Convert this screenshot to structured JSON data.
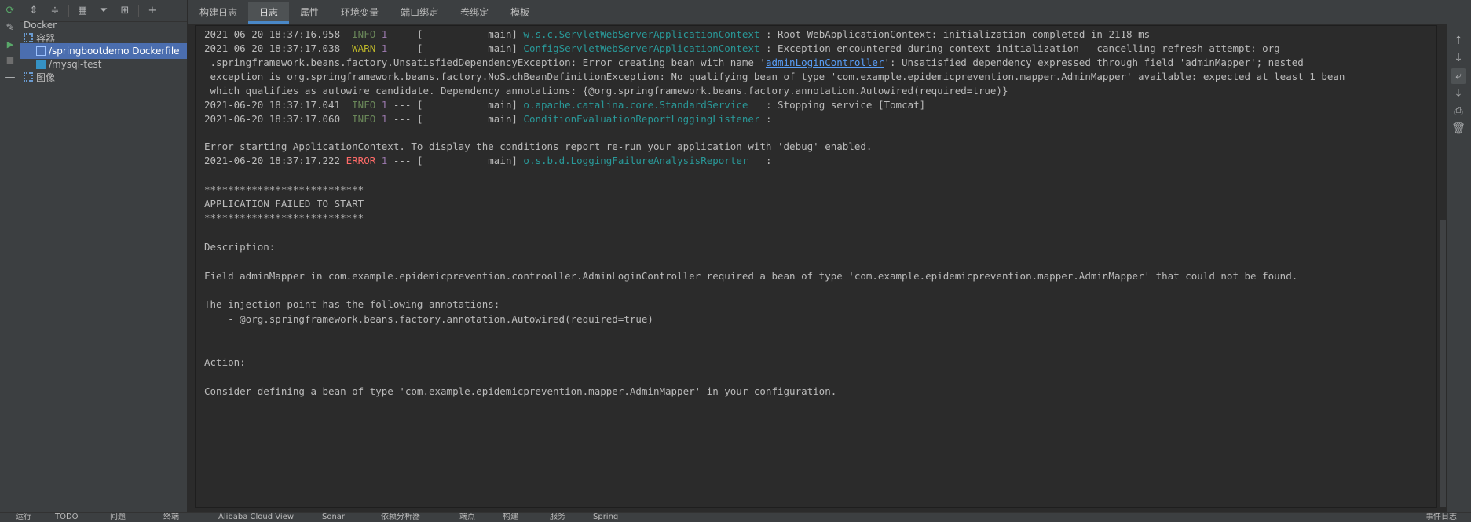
{
  "left_toolbar": {
    "icons": [
      "refresh-icon",
      "edit-icon",
      "run-icon",
      "stop-icon",
      "minus-icon"
    ]
  },
  "top_toolbar": {
    "icons": [
      "expand-all-icon",
      "collapse-all-icon",
      "group-icon",
      "filter-icon",
      "new-group-icon",
      "add-icon"
    ]
  },
  "tree": {
    "root": "Docker",
    "containers_label": "容器",
    "containers": [
      "/springbootdemo Dockerfile",
      "/mysql-test"
    ],
    "images_label": "图像"
  },
  "tabs": [
    "构建日志",
    "日志",
    "属性",
    "环境变量",
    "端口绑定",
    "卷绑定",
    "模板"
  ],
  "active_tab": "日志",
  "log": {
    "line1": {
      "ts": "2021-06-20 18:37:16.958  ",
      "level": "INFO",
      "pid": " 1",
      "sep": " --- [           main] ",
      "cls": "w.s.c.ServletWebServerApplicationContext",
      "msg": " : Root WebApplicationContext: initialization completed in 2118 ms"
    },
    "line2": {
      "ts": "2021-06-20 18:37:17.038  ",
      "level": "WARN",
      "pid": " 1",
      "sep": " --- [           main] ",
      "cls": "ConfigServletWebServerApplicationContext",
      "msg": " : Exception encountered during context initialization - cancelling refresh attempt: org"
    },
    "line3": {
      "pre": " .springframework.beans.factory.UnsatisfiedDependencyException: Error creating bean with name '",
      "link": "adminLoginController",
      "post": "': Unsatisfied dependency expressed through field 'adminMapper'; nested"
    },
    "line4": " exception is org.springframework.beans.factory.NoSuchBeanDefinitionException: No qualifying bean of type 'com.example.epidemicprevention.mapper.AdminMapper' available: expected at least 1 bean",
    "line5": " which qualifies as autowire candidate. Dependency annotations: {@org.springframework.beans.factory.annotation.Autowired(required=true)}",
    "line6": {
      "ts": "2021-06-20 18:37:17.041  ",
      "level": "INFO",
      "pid": " 1",
      "sep": " --- [           main] ",
      "cls": "o.apache.catalina.core.StandardService",
      "msg": "   : Stopping service [Tomcat]"
    },
    "line7": {
      "ts": "2021-06-20 18:37:17.060  ",
      "level": "INFO",
      "pid": " 1",
      "sep": " --- [           main] ",
      "cls": "ConditionEvaluationReportLoggingListener",
      "msg": " :"
    },
    "line8": "Error starting ApplicationContext. To display the conditions report re-run your application with 'debug' enabled.",
    "line9": {
      "ts": "2021-06-20 18:37:17.222 ",
      "level": "ERROR",
      "pid": " 1",
      "sep": " --- [           main] ",
      "cls": "o.s.b.d.LoggingFailureAnalysisReporter",
      "msg": "   :"
    },
    "stars": "***************************",
    "failed": "APPLICATION FAILED TO START",
    "description_label": "Description:",
    "description": "Field adminMapper in com.example.epidemicprevention.controoller.AdminLoginController required a bean of type 'com.example.epidemicprevention.mapper.AdminMapper' that could not be found.",
    "injection": "The injection point has the following annotations:",
    "annotation": "    - @org.springframework.beans.factory.annotation.Autowired(required=true)",
    "action_label": "Action:",
    "action": "Consider defining a bean of type 'com.example.epidemicprevention.mapper.AdminMapper' in your configuration."
  },
  "right_toolbar": {
    "icons": [
      "up-arrow-icon",
      "down-arrow-icon",
      "soft-wrap-icon",
      "scroll-to-end-icon",
      "print-icon",
      "trash-icon"
    ]
  },
  "status_bar": [
    "运行",
    "TODO",
    "问题",
    "终端",
    "Alibaba Cloud View",
    "Sonar",
    "依赖分析器",
    "端点",
    "构建",
    "服务",
    "Spring",
    "事件日志"
  ],
  "colors": {
    "background": "#2b2b2b",
    "panel": "#3c3f41",
    "selection": "#4b6eaf",
    "info": "#6a8759",
    "warn": "#bbb529",
    "error": "#ff6b68",
    "logger": "#299999",
    "pid": "#9876aa",
    "link": "#589df6"
  }
}
